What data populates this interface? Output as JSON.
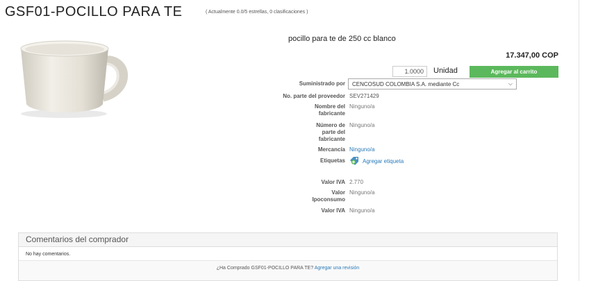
{
  "product": {
    "title": "GSF01-POCILLO PARA TE",
    "rating_text": "( Actualmente 0.0/5 estrellas, 0 clasificaciones )",
    "description": "pocillo para te de 250 cc blanco",
    "price": "17.347,00 COP",
    "quantity": "1.0000",
    "unit": "Unidad",
    "add_to_cart": "Agregar al carrito"
  },
  "details": {
    "supplied_by_label": "Suministrado por",
    "supplier_value": "CENCOSUD COLOMBIA S.A. mediante Cc",
    "supplier_part_label": "No. parte del proveedor",
    "supplier_part_value": "SEV271429",
    "manufacturer_label_1": "Nombre del",
    "manufacturer_label_2": "fabricante",
    "manufacturer_value": "Ninguno/a",
    "mfr_part_label_1": "Número de",
    "mfr_part_label_2": "parte del",
    "mfr_part_label_3": "fabricante",
    "mfr_part_value": "Ninguno/a",
    "merchandise_label": "Mercancía",
    "merchandise_value": "Ninguno/a",
    "tags_label": "Etiquetas",
    "add_tag": "Agregar etiqueta",
    "iva_label": "Valor IVA",
    "iva_value": "2.770",
    "ipoconsumo_label_1": "Valor",
    "ipoconsumo_label_2": "Ipoconsumo",
    "ipoconsumo_value": "Ninguno/a",
    "iva2_label": "Valor IVA",
    "iva2_value": "Ninguno/a"
  },
  "comments": {
    "header": "Comentarios del comprador",
    "empty_text": "No hay comentarios.",
    "prompt": "¿Ha Comprado GSF01-POCILLO PARA TE?",
    "review_link": "Agregar una revisión"
  },
  "colors": {
    "cart_button": "#5cb85c",
    "link": "#2a7ab8"
  }
}
